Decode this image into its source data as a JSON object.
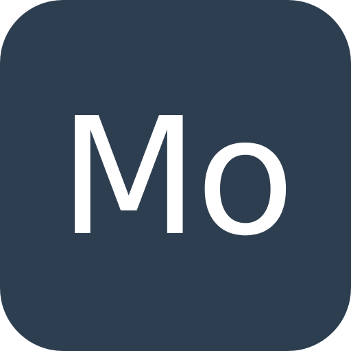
{
  "icon": {
    "text": "Mo",
    "background_color": "#2e3e51",
    "text_color": "#ffffff"
  }
}
